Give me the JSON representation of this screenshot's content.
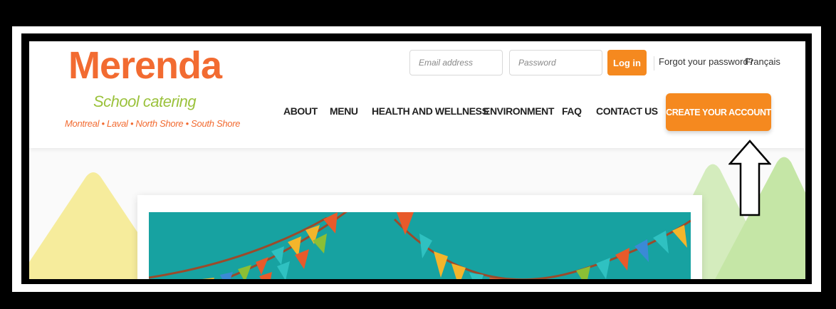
{
  "logo": {
    "name": "Merenda",
    "tagline": "School catering",
    "regions": "Montreal • Laval • North Shore • South Shore"
  },
  "login": {
    "email_placeholder": "Email address",
    "password_placeholder": "Password",
    "login_label": "Log in",
    "forgot_label": "Forgot your password?",
    "language_label": "Français"
  },
  "nav": {
    "items": [
      "ABOUT",
      "MENU",
      "HEALTH AND WELLNESS",
      "ENVIRONMENT",
      "FAQ",
      "CONTACT US"
    ],
    "cta_label": "CREATE YOUR ACCOUNT"
  },
  "colors": {
    "brand_orange": "#f26b31",
    "button_orange": "#f5891f",
    "tagline_green": "#9bc23c",
    "banner_teal": "#17a2a1"
  },
  "icons": {
    "annotation": "up-arrow-icon"
  }
}
